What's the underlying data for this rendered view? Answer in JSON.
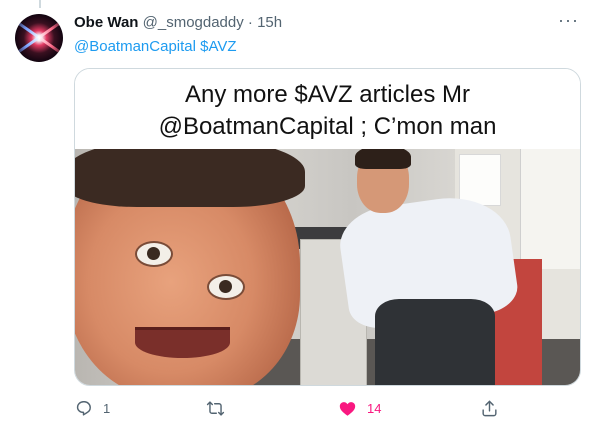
{
  "tweet": {
    "display_name": "Obe Wan",
    "handle": "@_smogdaddy",
    "separator": "·",
    "time": "15h",
    "more_label": "···",
    "reply_text": "@BoatmanCapital $AVZ"
  },
  "media": {
    "caption_line1": "Any more $AVZ articles Mr",
    "caption_line2": "@BoatmanCapital ; C’mon man"
  },
  "actions": {
    "reply_count": "1",
    "retweet_count": "",
    "like_count": "14",
    "like_color": "#f91880",
    "icons": [
      "reply-icon",
      "retweet-icon",
      "heart-icon",
      "share-icon"
    ]
  },
  "colors": {
    "link": "#1d9bf0",
    "secondary_text": "#536471",
    "border": "#cfd9de"
  }
}
